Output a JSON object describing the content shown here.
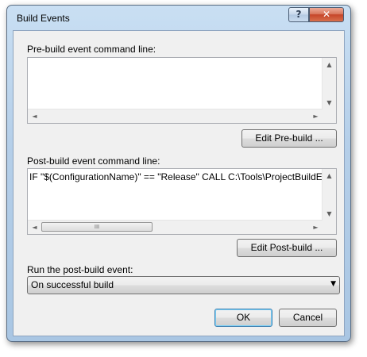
{
  "window": {
    "title": "Build Events",
    "help_label": "?",
    "close_label": "✕"
  },
  "prebuild": {
    "label": "Pre-build event command line:",
    "value": "",
    "edit_button": "Edit Pre-build ..."
  },
  "postbuild": {
    "label": "Post-build event command line:",
    "value": "IF \"$(ConfigurationName)\" == \"Release\" CALL C:\\Tools\\ProjectBuildE",
    "edit_button": "Edit Post-build ..."
  },
  "run": {
    "label": "Run the post-build event:",
    "selected": "On successful build"
  },
  "buttons": {
    "ok": "OK",
    "cancel": "Cancel"
  },
  "icons": {
    "scroll_up": "▲",
    "scroll_down": "▼",
    "scroll_left": "◄",
    "scroll_right": "►",
    "grip": "III",
    "dropdown": "▼"
  }
}
